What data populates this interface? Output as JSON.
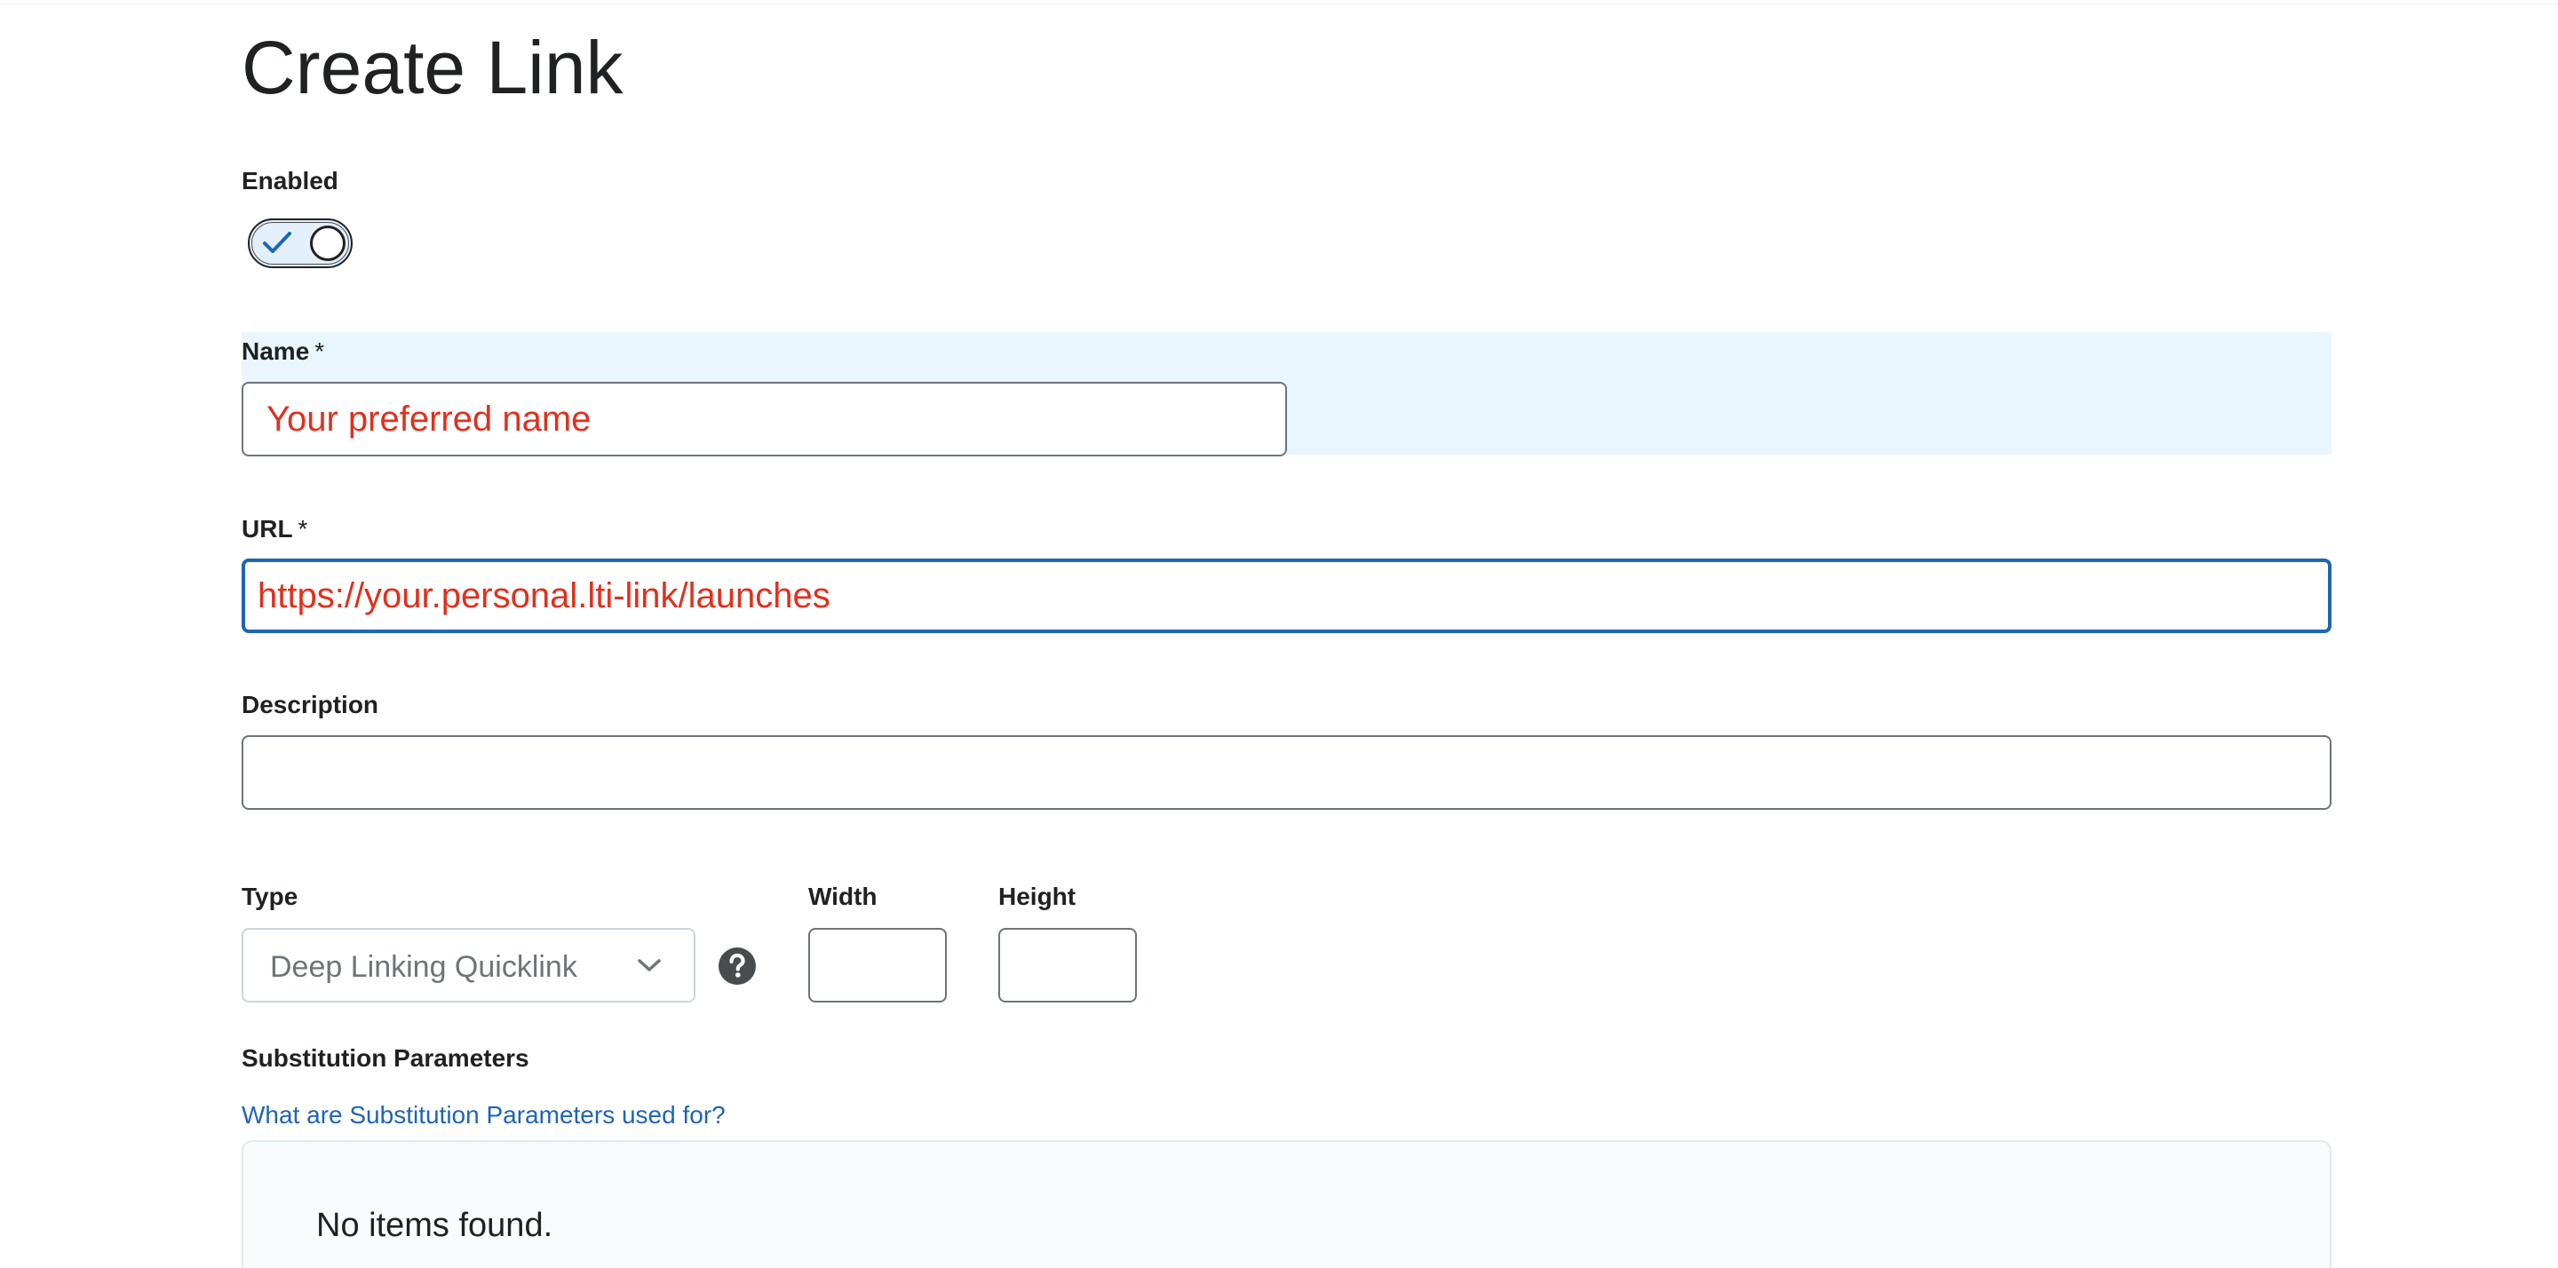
{
  "page": {
    "title": "Create Link"
  },
  "enabled": {
    "label": "Enabled",
    "checked": true
  },
  "name": {
    "label": "Name",
    "required_mark": "*",
    "value": "Your preferred name"
  },
  "url": {
    "label": "URL",
    "required_mark": "*",
    "value": "https://your.personal.lti-link/launches"
  },
  "description": {
    "label": "Description",
    "value": ""
  },
  "type": {
    "label": "Type",
    "selected": "Deep Linking Quicklink"
  },
  "width": {
    "label": "Width",
    "value": ""
  },
  "height": {
    "label": "Height",
    "value": ""
  },
  "substitution": {
    "label": "Substitution Parameters",
    "help_link": "What are Substitution Parameters used for?",
    "empty_text": "No items found."
  },
  "colors": {
    "accent": "#1e65b5",
    "entered_text": "#e0301e",
    "highlight_bg": "#e9f6fd"
  },
  "icons": {
    "toggle": "check-icon",
    "type_dropdown": "chevron-down-icon",
    "type_help": "help-circle-icon"
  }
}
